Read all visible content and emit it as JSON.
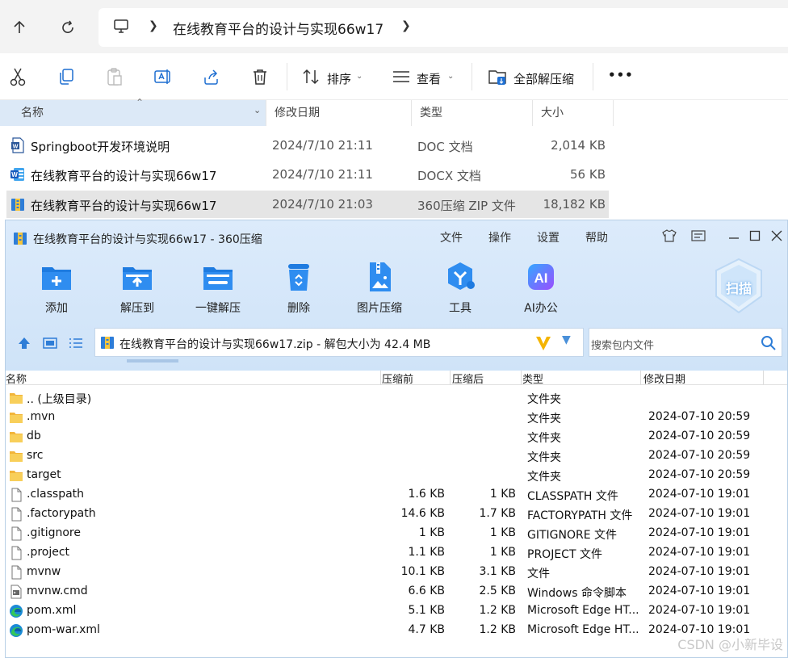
{
  "explorer": {
    "breadcrumb": {
      "path": "在线教育平台的设计与实现66w17"
    },
    "toolbar": {
      "sort_label": "排序",
      "view_label": "查看",
      "extract_all_label": "全部解压缩",
      "more_label": "•••"
    },
    "columns": [
      "名称",
      "修改日期",
      "类型",
      "大小"
    ],
    "files": [
      {
        "name": "Springboot开发环境说明",
        "date": "2024/7/10 21:11",
        "type": "DOC 文档",
        "size": "2,014 KB",
        "icon": "word-doc-icon"
      },
      {
        "name": "在线教育平台的设计与实现66w17",
        "date": "2024/7/10 21:11",
        "type": "DOCX 文档",
        "size": "56 KB",
        "icon": "word-docx-icon"
      },
      {
        "name": "在线教育平台的设计与实现66w17",
        "date": "2024/7/10 21:03",
        "type": "360压缩 ZIP 文件",
        "size": "18,182 KB",
        "icon": "zip-archive-icon"
      }
    ]
  },
  "zip": {
    "title": "在线教育平台的设计与实现66w17 - 360压缩",
    "menu": [
      "文件",
      "操作",
      "设置",
      "帮助"
    ],
    "tools": [
      {
        "label": "添加",
        "icon": "add-icon"
      },
      {
        "label": "解压到",
        "icon": "extract-to-icon"
      },
      {
        "label": "一键解压",
        "icon": "one-click-extract-icon"
      },
      {
        "label": "删除",
        "icon": "delete-icon"
      },
      {
        "label": "图片压缩",
        "icon": "image-compress-icon"
      },
      {
        "label": "工具",
        "icon": "tools-icon"
      },
      {
        "label": "AI办公",
        "icon": "ai-office-icon"
      }
    ],
    "scan_label": "扫描",
    "ai_badge": "AI",
    "path_text": "在线教育平台的设计与实现66w17.zip - 解包大小为 42.4 MB",
    "search_placeholder": "搜索包内文件",
    "columns": [
      "名称",
      "压缩前",
      "压缩后",
      "类型",
      "修改日期"
    ],
    "rows": [
      {
        "name": ".. (上级目录)",
        "before": "",
        "after": "",
        "type": "文件夹",
        "date": "",
        "icon": "folder-icon"
      },
      {
        "name": ".mvn",
        "before": "",
        "after": "",
        "type": "文件夹",
        "date": "2024-07-10 20:59",
        "icon": "folder-icon"
      },
      {
        "name": "db",
        "before": "",
        "after": "",
        "type": "文件夹",
        "date": "2024-07-10 20:59",
        "icon": "folder-icon"
      },
      {
        "name": "src",
        "before": "",
        "after": "",
        "type": "文件夹",
        "date": "2024-07-10 20:59",
        "icon": "folder-icon"
      },
      {
        "name": "target",
        "before": "",
        "after": "",
        "type": "文件夹",
        "date": "2024-07-10 20:59",
        "icon": "folder-icon"
      },
      {
        "name": ".classpath",
        "before": "1.6 KB",
        "after": "1 KB",
        "type": "CLASSPATH 文件",
        "date": "2024-07-10 19:01",
        "icon": "file-icon"
      },
      {
        "name": ".factorypath",
        "before": "14.6 KB",
        "after": "1.7 KB",
        "type": "FACTORYPATH 文件",
        "date": "2024-07-10 19:01",
        "icon": "file-icon"
      },
      {
        "name": ".gitignore",
        "before": "1 KB",
        "after": "1 KB",
        "type": "GITIGNORE 文件",
        "date": "2024-07-10 19:01",
        "icon": "file-icon"
      },
      {
        "name": ".project",
        "before": "1.1 KB",
        "after": "1 KB",
        "type": "PROJECT 文件",
        "date": "2024-07-10 19:01",
        "icon": "file-icon"
      },
      {
        "name": "mvnw",
        "before": "10.1 KB",
        "after": "3.1 KB",
        "type": "文件",
        "date": "2024-07-10 19:01",
        "icon": "file-icon"
      },
      {
        "name": "mvnw.cmd",
        "before": "6.6 KB",
        "after": "2.5 KB",
        "type": "Windows 命令脚本",
        "date": "2024-07-10 19:01",
        "icon": "cmd-script-icon"
      },
      {
        "name": "pom.xml",
        "before": "5.1 KB",
        "after": "1.2 KB",
        "type": "Microsoft Edge HT...",
        "date": "2024-07-10 19:01",
        "icon": "edge-icon"
      },
      {
        "name": "pom-war.xml",
        "before": "4.7 KB",
        "after": "1.2 KB",
        "type": "Microsoft Edge HT...",
        "date": "2024-07-10 19:01",
        "icon": "edge-icon"
      }
    ]
  },
  "watermark": "CSDN @小新毕设",
  "colors": {
    "accent_blue": "#2b7de1",
    "folder_yellow": "#f5c342",
    "selected_row": "#e5e5e5",
    "header_selected": "#dce9f7"
  }
}
